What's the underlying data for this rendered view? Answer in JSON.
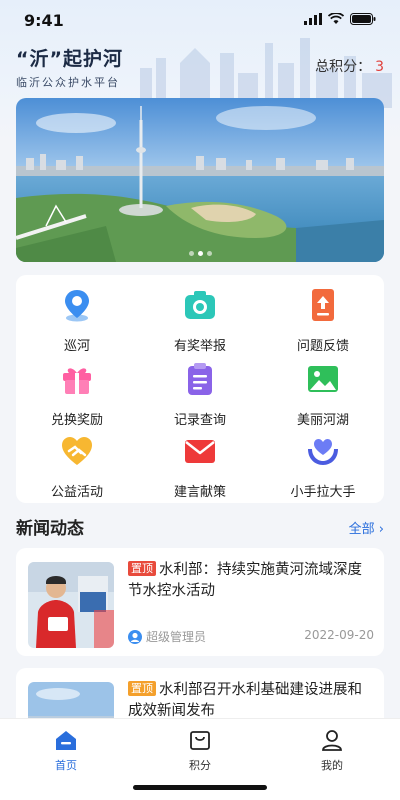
{
  "status_bar": {
    "time": "9:41"
  },
  "header": {
    "title": "“沂”起护河",
    "subtitle": "临沂公众护水平台",
    "points_label": "总积分：",
    "points_value": "3"
  },
  "banner": {
    "page_count": 3,
    "active_index": 0
  },
  "menu": {
    "items": [
      {
        "label": "巡河",
        "icon": "location-pin-icon"
      },
      {
        "label": "有奖举报",
        "icon": "camera-icon"
      },
      {
        "label": "问题反馈",
        "icon": "upload-icon"
      },
      {
        "label": "兑换奖励",
        "icon": "gift-icon"
      },
      {
        "label": "记录查询",
        "icon": "clipboard-icon"
      },
      {
        "label": "美丽河湖",
        "icon": "landscape-image-icon"
      },
      {
        "label": "公益活动",
        "icon": "heart-hands-icon"
      },
      {
        "label": "建言献策",
        "icon": "envelope-icon"
      },
      {
        "label": "小手拉大手",
        "icon": "hands-heart-icon"
      }
    ]
  },
  "news": {
    "section_title": "新闻动态",
    "more_label": "全部",
    "items": [
      {
        "tag": "置顶",
        "title": "水利部：持续实施黄河流域深度节水控水活动",
        "author": "超级管理员",
        "date": "2022-09-20"
      },
      {
        "tag": "置顶",
        "title": "水利部召开水利基础建设进展和成效新闻发布"
      }
    ]
  },
  "tab_bar": {
    "tabs": [
      {
        "label": "首页",
        "icon": "home-icon",
        "active": true
      },
      {
        "label": "积分",
        "icon": "shopping-bag-icon",
        "active": false
      },
      {
        "label": "我的",
        "icon": "user-icon",
        "active": false
      }
    ]
  },
  "colors": {
    "accent": "#2a6edc",
    "points": "#e0403c",
    "tag_orange": "#f4a02c",
    "tag_red": "#e84b3c"
  }
}
